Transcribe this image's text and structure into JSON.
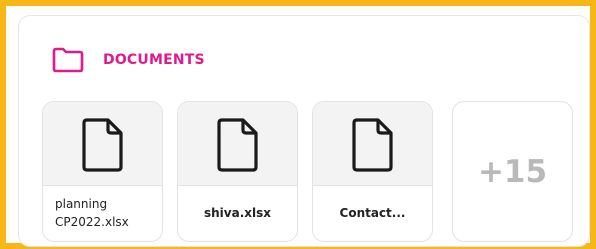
{
  "section": {
    "title": "DOCUMENTS",
    "icon": "folder-icon",
    "accent_color": "#e01a8e",
    "frame_color": "#f7b716"
  },
  "documents": [
    {
      "name": "planning\nCP2022.xlsx",
      "icon": "file-icon"
    },
    {
      "name": "shiva.xlsx",
      "icon": "file-icon"
    },
    {
      "name": "Contact...",
      "icon": "file-icon"
    }
  ],
  "more": {
    "label": "+15"
  }
}
